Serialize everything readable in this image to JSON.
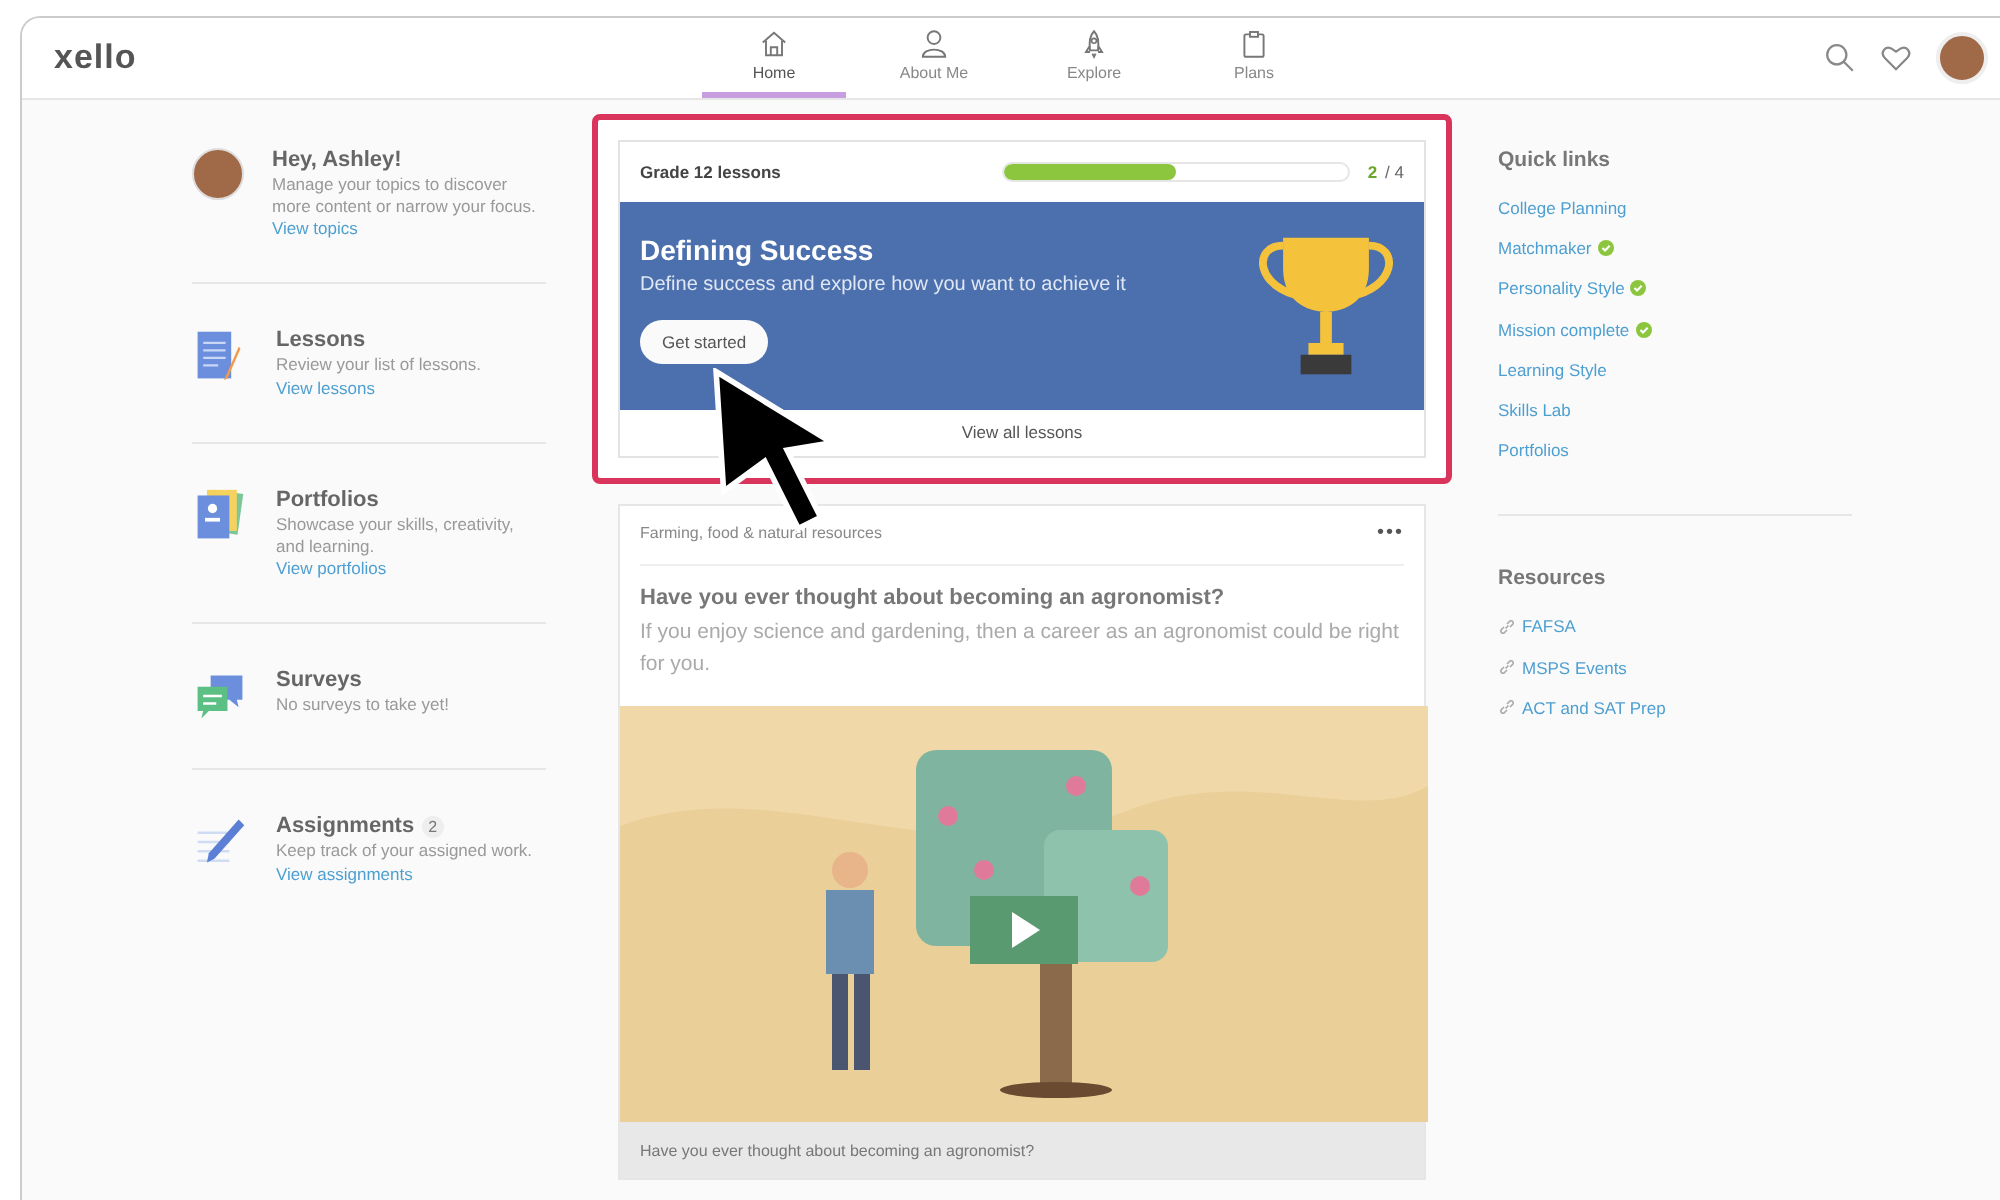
{
  "header": {
    "logo": "xello",
    "nav": [
      {
        "label": "Home",
        "selected": true
      },
      {
        "label": "About Me",
        "selected": false
      },
      {
        "label": "Explore",
        "selected": false
      },
      {
        "label": "Plans",
        "selected": false
      }
    ]
  },
  "sidebar": {
    "items": [
      {
        "kind": "profile",
        "title": "Hey, Ashley!",
        "description": "Manage your topics to discover more content or narrow your focus.",
        "link": "View topics"
      },
      {
        "kind": "lessons",
        "title": "Lessons",
        "description": "Review your list of lessons.",
        "link": "View lessons"
      },
      {
        "kind": "portfolios",
        "title": "Portfolios",
        "description": "Showcase your skills, creativity, and learning.",
        "link": "View portfolios"
      },
      {
        "kind": "surveys",
        "title": "Surveys",
        "description": "No surveys to take yet!"
      },
      {
        "kind": "assignments",
        "title": "Assignments",
        "count": "2",
        "description": "Keep track of your assigned work.",
        "link": "View assignments"
      }
    ]
  },
  "lesson_card": {
    "title": "Grade 12 lessons",
    "progress": {
      "level": 0.5,
      "done": "2",
      "total": "/ 4"
    },
    "banner": {
      "title": "Defining Success",
      "subtitle": "Define success and explore how you want to achieve it",
      "button": "Get started"
    },
    "view_all": "View all lessons"
  },
  "feed_card": {
    "category": "Farming, food & natural resources",
    "menu": "•••",
    "heading": "Have you ever thought about becoming an agronomist?",
    "body": "If you enjoy science and gardening, then a career as an agronomist could be right for you.",
    "video_caption": "Have you ever thought about becoming an agronomist?"
  },
  "quick_links": {
    "heading": "Quick links",
    "items": [
      {
        "label": "College Planning",
        "completed": false
      },
      {
        "label": "Matchmaker",
        "completed": true
      },
      {
        "label": "Personality Style",
        "completed": true
      },
      {
        "label": "Mission complete",
        "completed": true
      },
      {
        "label": "Learning Style",
        "completed": false
      },
      {
        "label": "Skills Lab",
        "completed": false
      },
      {
        "label": "Portfolios",
        "completed": false
      }
    ]
  },
  "resources": {
    "heading": "Resources",
    "items": [
      {
        "label": "FAFSA"
      },
      {
        "label": "MSPS Events"
      },
      {
        "label": "ACT and SAT Prep"
      }
    ]
  }
}
